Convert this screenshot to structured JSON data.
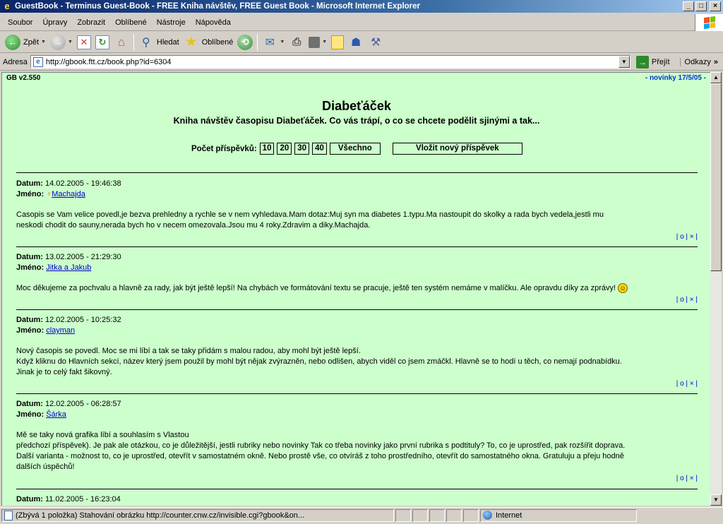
{
  "window": {
    "title": "GuestBook - Terminus Guest-Book - FREE Kniha návštěv, FREE Guest Book - Microsoft Internet Explorer",
    "min": "_",
    "max": "□",
    "close": "×"
  },
  "menu": [
    "Soubor",
    "Úpravy",
    "Zobrazit",
    "Oblíbené",
    "Nástroje",
    "Nápověda"
  ],
  "toolbar": {
    "back": "Zpět",
    "search": "Hledat",
    "favorites": "Oblíbené"
  },
  "address": {
    "label": "Adresa",
    "url": "http://gbook.ftt.cz/book.php?id=6304",
    "go": "Přejít",
    "links": "Odkazy",
    "more": "»"
  },
  "page": {
    "version": "GB v2.550",
    "news": "- novinky 17/5/05 -",
    "title": "Diabeťáček",
    "subtitle": "Kniha návštěv časopisu Diabeťáček. Co vás trápí, o co se chcete podělit sjinými a tak...",
    "count_label": "Počet příspěvků:",
    "count_options": [
      "10",
      "20",
      "30",
      "40"
    ],
    "all": "Všechno",
    "new_post": "Vložit nový příspěvek",
    "date_label": "Datum:",
    "name_label": "Jméno:",
    "actions": "| o | × |"
  },
  "entries": [
    {
      "date": "14.02.2005 - 19:46:38",
      "name": "Machajda",
      "lines": [
        "Casopis se Vam velice povedl,je bezva prehledny a rychle se v nem vyhledava.Mam dotaz:Muj syn ma diabetes 1.typu.Ma nastoupit do skolky a rada bych vedela,jestli mu",
        "neskodi chodit do sauny,nerada bych ho v necem omezovala.Jsou mu 4 roky.Zdravim a diky.Machajda."
      ]
    },
    {
      "date": "13.02.2005 - 21:29:30",
      "name": "Jitka a Jakub",
      "lines": [
        "Moc děkujeme za pochvalu a hlavně za rady, jak být ještě lepší! Na chybách ve formátování textu se pracuje, ještě ten systém nemáme v malíčku. Ale opravdu díky za zprávy!"
      ]
    },
    {
      "date": "12.02.2005 - 10:25:32",
      "name": "clayman",
      "lines": [
        "Nový časopis se povedl. Moc se mi líbí a tak se taky přidám s malou radou, aby mohl být ještě lepší.",
        "Když kliknu do Hlavních sekcí, název který jsem použil by mohl být nějak zvýrazněn, nebo odlišen, abych viděl co jsem zmáčkl. Hlavně se to hodí u těch, co nemají podnabídku.",
        "Jinak je to celý fakt šikovný."
      ]
    },
    {
      "date": "12.02.2005 - 06:28:57",
      "name": "Šárka",
      "lines": [
        "Mě se taky nová grafika líbí a souhlasím s Vlastou",
        "předchozí příspěvek). Je pak ale otázkou, co je důležitější, jestli rubriky nebo novinky Tak co třeba novinky jako první rubrika s podtituly? To, co je uprostřed, pak rozšířit doprava.",
        "Další varianta - možnost to, co je uprostřed, otevřít v samostatném okně. Nebo prostě vše, co otvíráš z toho prostředního, otevřít do samostatného okna. Gratuluju a přeju hodně",
        "dalších úspěchů!"
      ]
    },
    {
      "date": "11.02.2005 - 16:23:04"
    }
  ],
  "status": {
    "text": "(Zbývá 1 položka) Stahování obrázku http://counter.cnw.cz/invisible.cgi?gbook&on...",
    "zone": "Internet"
  }
}
